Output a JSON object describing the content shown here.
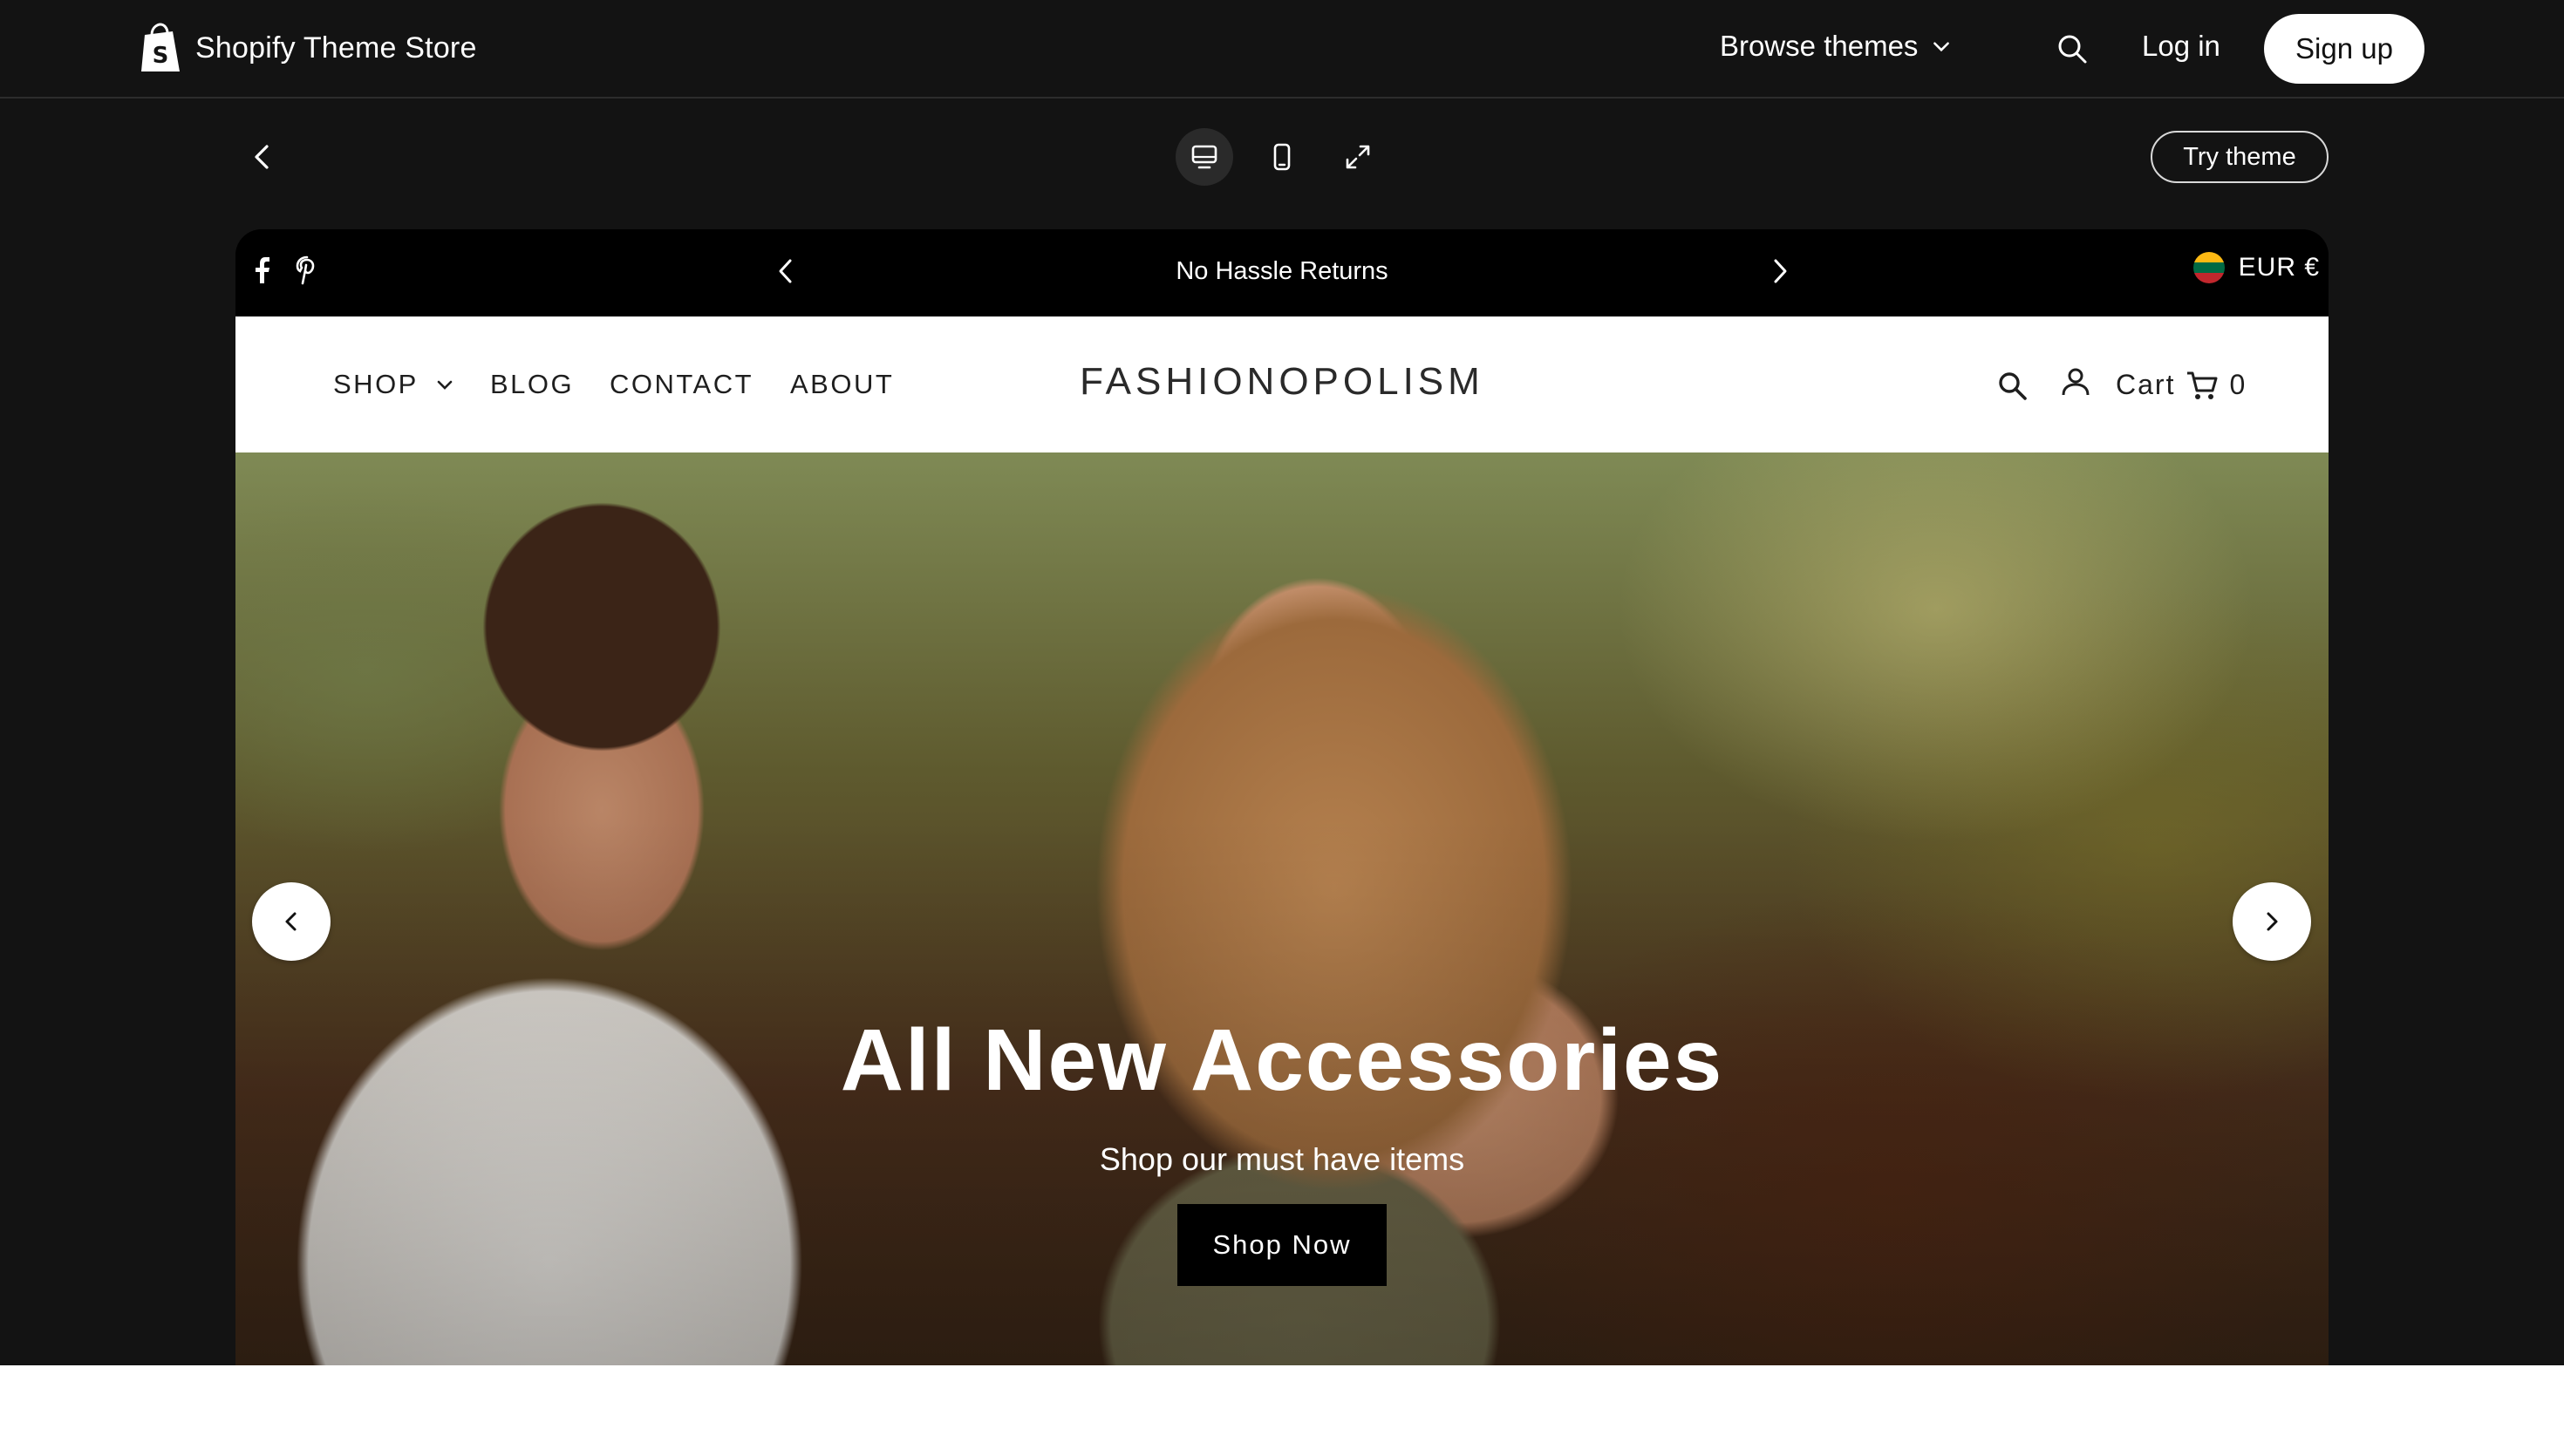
{
  "store_header": {
    "title": "Shopify Theme Store",
    "browse_label": "Browse themes",
    "login_label": "Log in",
    "signup_label": "Sign up"
  },
  "toolbar": {
    "try_theme_label": "Try theme"
  },
  "announcement": {
    "text": "No Hassle Returns",
    "currency": "EUR €"
  },
  "nav": {
    "items": [
      "SHOP",
      "BLOG",
      "CONTACT",
      "ABOUT"
    ],
    "brand": "FASHIONOPOLISM",
    "cart_label": "Cart",
    "cart_count": "0"
  },
  "hero": {
    "title": "All New Accessories",
    "subtitle": "Shop our must have items",
    "button_label": "Shop Now"
  },
  "colors": {
    "page_bg": "#131313",
    "accent": "#000000"
  }
}
